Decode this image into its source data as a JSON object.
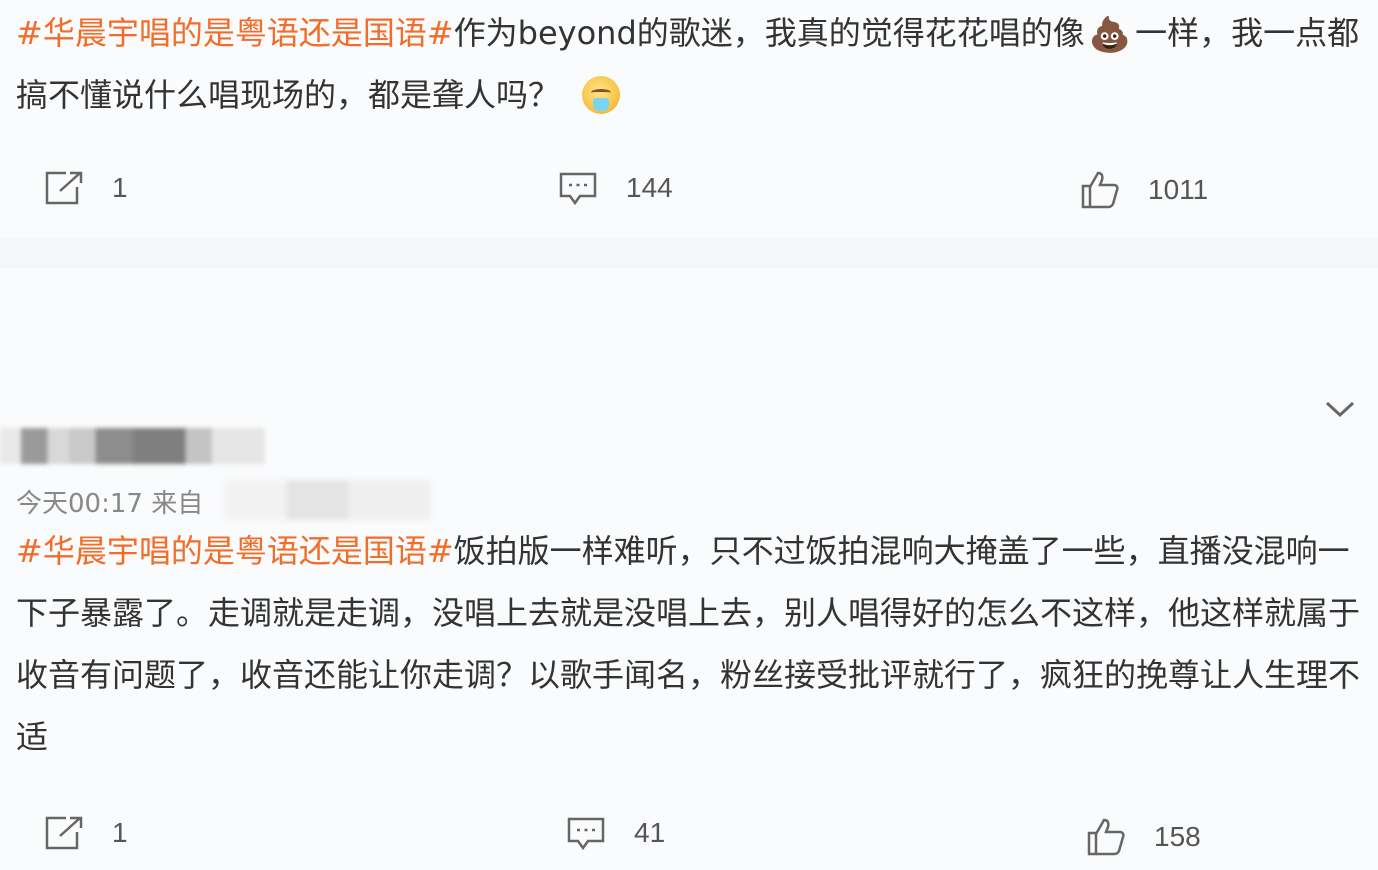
{
  "posts": [
    {
      "tag": "#华晨宇唱的是粤语还是国语#",
      "text_a": "作为beyond的歌迷，我真的觉得花花唱的像",
      "emoji_a": "💩",
      "text_b": "一样，我一点都搞不懂说什么唱现场的，都是聋人吗？",
      "emoji_b": "grinning-sweat-face",
      "repost_count": "1",
      "comment_count": "144",
      "like_count": "1011"
    },
    {
      "timestamp": "今天00:17  来自",
      "tag": "#华晨宇唱的是粤语还是国语#",
      "text": "饭拍版一样难听，只不过饭拍混响大掩盖了一些，直播没混响一下子暴露了。走调就是走调，没唱上去就是没唱上去，别人唱得好的怎么不这样，他这样就属于收音有问题了，收音还能让你走调？以歌手闻名，粉丝接受批评就行了，疯狂的挽尊让人生理不适",
      "repost_count": "1",
      "comment_count": "41",
      "like_count": "158"
    }
  ],
  "icons": {
    "repost": "repost-icon",
    "comment": "comment-icon",
    "like": "thumbs-up-icon",
    "expand": "chevron-down-icon"
  },
  "colors": {
    "tag": "#f26c2a",
    "text": "#333333",
    "meta": "#888888"
  }
}
